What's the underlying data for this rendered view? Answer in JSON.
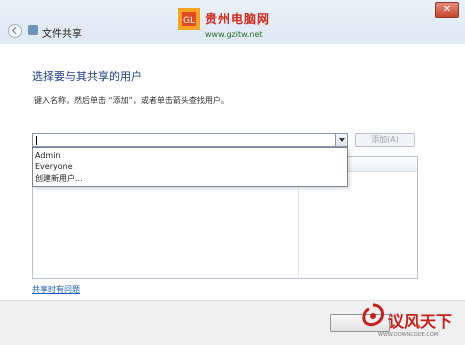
{
  "window": {
    "title": "文件共享",
    "close_glyph": "✕"
  },
  "watermark_top": {
    "site": "贵州电脑网",
    "url": "www.gzitw.net"
  },
  "dialog": {
    "heading": "选择要与其共享的用户",
    "instruction": "键入名称，然后单击 “添加”，或者单击箭头查找用户。",
    "combo": {
      "value": "",
      "options": [
        "Admin",
        "Everyone",
        "创建新用户..."
      ]
    },
    "add_button": "添加(A)",
    "problem_link": "共享时有问题"
  },
  "watermark_bottom": {
    "text": "议风天下",
    "sub": "WWW.DOWNCODE.COM"
  },
  "colors": {
    "heading": "#1c3f86",
    "link": "#1a5cb8",
    "watermark_red": "#d5281b"
  }
}
